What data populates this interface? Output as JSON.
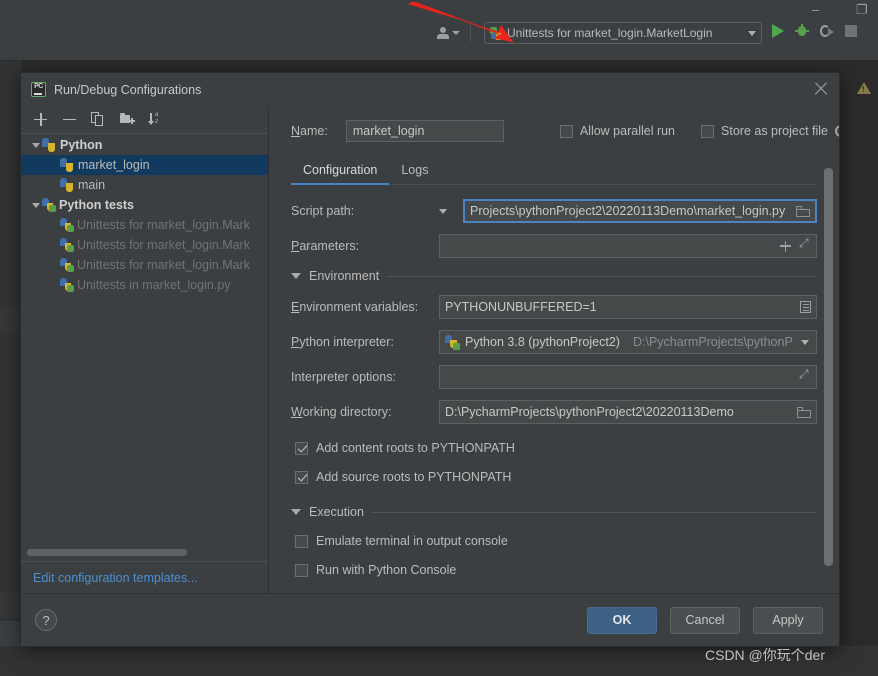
{
  "ide": {
    "window_controls": {
      "minimize": "–",
      "maximize": "❐"
    },
    "toolbar": {
      "person_icon": "user-icon",
      "run_config_selector": {
        "label": "Unittests for market_login.MarketLogin",
        "icon": "python-test-icon",
        "caret": "chevron-down-icon"
      },
      "run_icon": "run-icon",
      "debug_icon": "debug-icon",
      "coverage_icon": "coverage-icon",
      "stop_icon": "stop-icon"
    },
    "warning_icon": "warning-triangle-icon"
  },
  "dialog": {
    "title": "Run/Debug Configurations",
    "app_icon": "pycharm-icon",
    "close_icon": "close-icon",
    "tree_toolbar": [
      {
        "name": "add",
        "icon": "plus-icon"
      },
      {
        "name": "remove",
        "icon": "minus-icon"
      },
      {
        "name": "copy",
        "icon": "copy-icon"
      },
      {
        "name": "save-configuration",
        "icon": "folder-add-icon"
      },
      {
        "name": "sort-alphabetically",
        "icon": "sort-az-icon"
      }
    ],
    "tree": [
      {
        "label": "Python",
        "type": "group",
        "icon": "python-icon",
        "expanded": true,
        "selected": false
      },
      {
        "label": "market_login",
        "type": "config",
        "icon": "python-icon",
        "selected": true
      },
      {
        "label": "main",
        "type": "config",
        "icon": "python-icon",
        "selected": false
      },
      {
        "label": "Python tests",
        "type": "group",
        "icon": "python-test-icon",
        "expanded": true,
        "selected": false
      },
      {
        "label": "Unittests for market_login.Mark",
        "type": "config",
        "icon": "python-test-icon",
        "selected": false,
        "dim": true
      },
      {
        "label": "Unittests for market_login.Mark",
        "type": "config",
        "icon": "python-test-icon",
        "selected": false,
        "dim": true
      },
      {
        "label": "Unittests for market_login.Mark",
        "type": "config",
        "icon": "python-test-icon",
        "selected": false,
        "dim": true
      },
      {
        "label": "Unittests in market_login.py",
        "type": "config",
        "icon": "python-test-icon",
        "selected": false,
        "dim": true
      }
    ],
    "edit_templates_link": "Edit configuration templates...",
    "form": {
      "name_label": "Name:",
      "name_value": "market_login",
      "allow_parallel_run": {
        "label": "Allow parallel run",
        "checked": false
      },
      "store_as_project_file": {
        "label": "Store as project file",
        "checked": false,
        "gear_icon": "gear-icon"
      },
      "tabs": [
        {
          "label": "Configuration",
          "active": true
        },
        {
          "label": "Logs",
          "active": false
        }
      ],
      "script_path": {
        "label": "Script path:",
        "value": "Projects\\pythonProject2\\20220113Demo\\market_login.py",
        "focused": true,
        "browse_icon": "folder-icon",
        "dropdown_icon": "chevron-down-icon"
      },
      "parameters": {
        "label": "Parameters:",
        "value": "",
        "add_icon": "plus-icon",
        "expand_icon": "expand-icon"
      },
      "environment_section": {
        "title": "Environment",
        "expanded": true,
        "caret": "chevron-down-icon"
      },
      "environment_variables": {
        "label": "Environment variables:",
        "value": "PYTHONUNBUFFERED=1",
        "edit_icon": "list-edit-icon"
      },
      "python_interpreter": {
        "label": "Python interpreter:",
        "value": "Python 3.8 (pythonProject2)",
        "path_hint": "D:\\PycharmProjects\\pythonP",
        "icon": "python-interpreter-icon",
        "dropdown_icon": "chevron-down-icon"
      },
      "interpreter_options": {
        "label": "Interpreter options:",
        "value": "",
        "expand_icon": "expand-icon"
      },
      "working_directory": {
        "label": "Working directory:",
        "value": "D:\\PycharmProjects\\pythonProject2\\20220113Demo",
        "browse_icon": "folder-icon"
      },
      "add_content_roots": {
        "label": "Add content roots to PYTHONPATH",
        "checked": true
      },
      "add_source_roots": {
        "label": "Add source roots to PYTHONPATH",
        "checked": true
      },
      "execution_section": {
        "title": "Execution",
        "expanded": true,
        "caret": "chevron-down-icon"
      },
      "emulate_terminal": {
        "label": "Emulate terminal in output console",
        "checked": false
      },
      "run_with_console": {
        "label": "Run with Python Console",
        "checked": false
      }
    },
    "footer": {
      "help_label": "?",
      "ok_label": "OK",
      "cancel_label": "Cancel",
      "apply_label": "Apply"
    }
  },
  "annotation": {
    "arrow": "red-arrow-pointer"
  },
  "watermark": "CSDN @你玩个der",
  "colors": {
    "accent_blue": "#4b83c4",
    "ok_button": "#3d6185",
    "selection": "#123a5e",
    "link": "#4d8fd1",
    "dialog_bg": "#3c3f41",
    "editor_bg": "#2b2b2b",
    "arrow_red": "#e8241c"
  }
}
